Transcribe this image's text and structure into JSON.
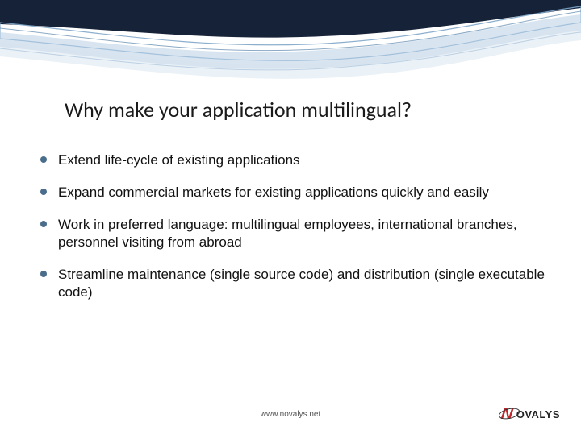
{
  "title": "Why make your application multilingual?",
  "bullets": {
    "b0": "Extend life-cycle of existing applications",
    "b1": "Expand commercial markets for existing applications quickly and easily",
    "b2": "Work in preferred language: multilingual employees, international branches, personnel visiting from abroad",
    "b3": "Streamline maintenance (single source code) and distribution (single executable code)"
  },
  "footer_url": "www.novalys.net",
  "logo": {
    "mark": "N",
    "text": "OVALYS"
  },
  "colors": {
    "accent": "#4a6d8c",
    "brand_red": "#c1272d"
  }
}
